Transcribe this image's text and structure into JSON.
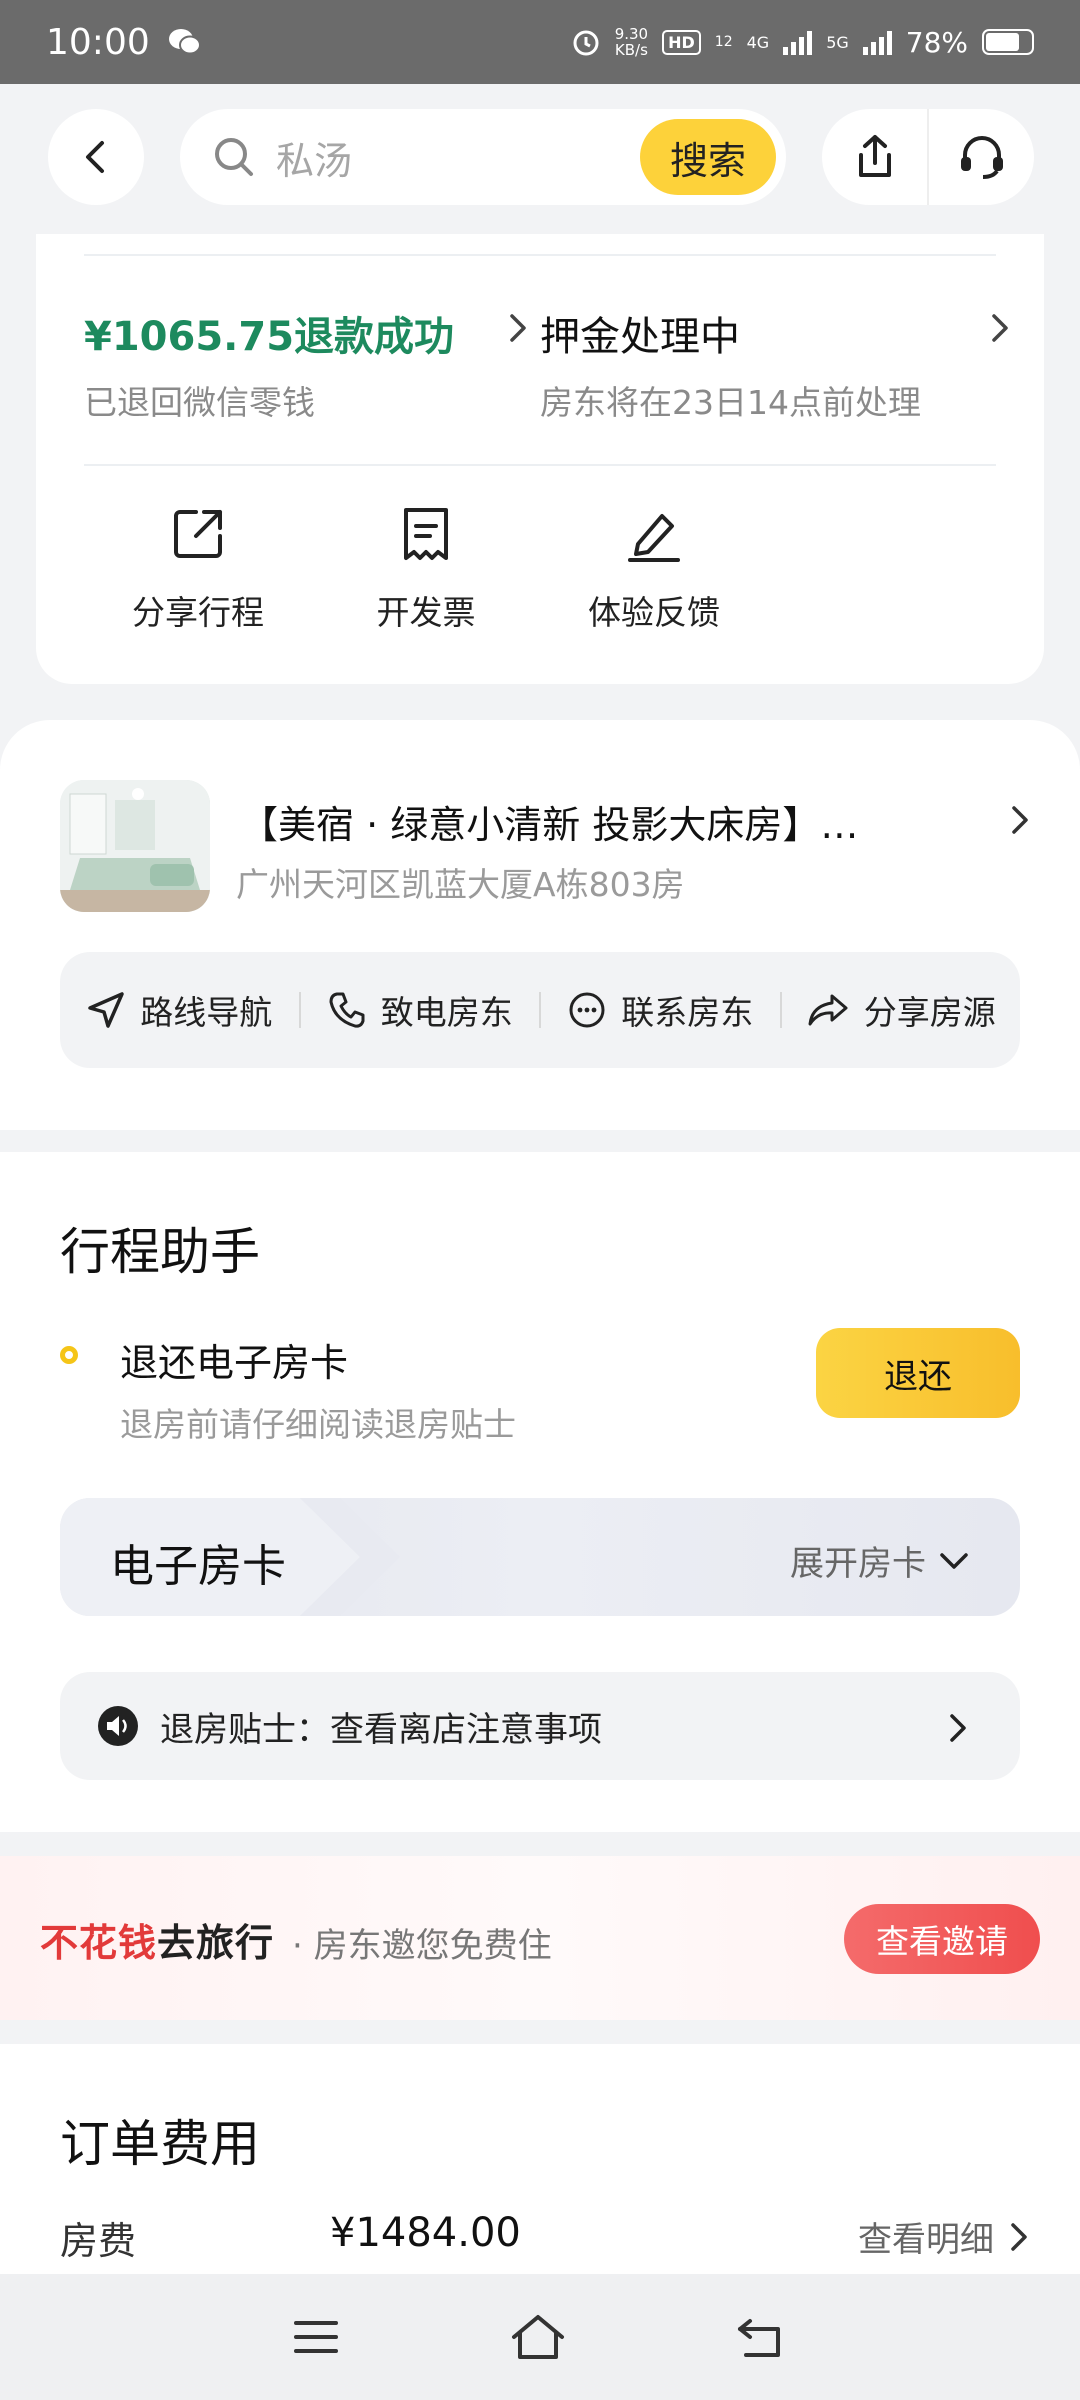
{
  "status_bar": {
    "time": "10:00",
    "net_speed_value": "9.30",
    "net_speed_unit": "KB/s",
    "hd_label": "HD",
    "hd_sub": "12",
    "net1": "4G",
    "net2": "5G",
    "battery": "78%",
    "battery_level": 0.78
  },
  "header": {
    "search_placeholder": "私汤",
    "search_button": "搜索",
    "icons": [
      "back-icon",
      "search-icon",
      "share-icon",
      "customer-service-icon"
    ]
  },
  "refund": {
    "amount_text": "¥1065.75退款成功",
    "sub_text": "已退回微信零钱"
  },
  "deposit": {
    "title": "押金处理中",
    "sub_text": "房东将在23日14点前处理"
  },
  "quick_actions": [
    {
      "label": "分享行程",
      "icon": "share-trip-icon"
    },
    {
      "label": "开发票",
      "icon": "invoice-icon"
    },
    {
      "label": "体验反馈",
      "icon": "feedback-icon"
    }
  ],
  "listing": {
    "title": "【美宿 · 绿意小清新 投影大床房】…",
    "address": "广州天河区凯蓝大厦A栋803房",
    "actions": [
      {
        "label": "路线导航",
        "icon": "navigation-icon"
      },
      {
        "label": "致电房东",
        "icon": "phone-icon"
      },
      {
        "label": "联系房东",
        "icon": "chat-icon"
      },
      {
        "label": "分享房源",
        "icon": "share-arrow-icon"
      }
    ]
  },
  "trip_assistant": {
    "title": "行程助手",
    "step_title": "退还电子房卡",
    "step_sub": "退房前请仔细阅读退房贴士",
    "return_button": "退还",
    "ekey_title": "电子房卡",
    "ekey_expand": "展开房卡",
    "tips_text": "退房贴士：查看离店注意事项"
  },
  "banner": {
    "main_red": "不花钱",
    "main_dark": "去旅行",
    "sub_text": "· 房东邀您免费住",
    "button": "查看邀请"
  },
  "order_fees": {
    "title": "订单费用",
    "room_fee_label": "房费",
    "room_fee_amount": "¥1484.00",
    "detail_link": "查看明细"
  },
  "colors": {
    "accent_yellow": "#fdd23a",
    "refund_green": "#1d8a5e",
    "banner_red": "#e23a3a"
  }
}
